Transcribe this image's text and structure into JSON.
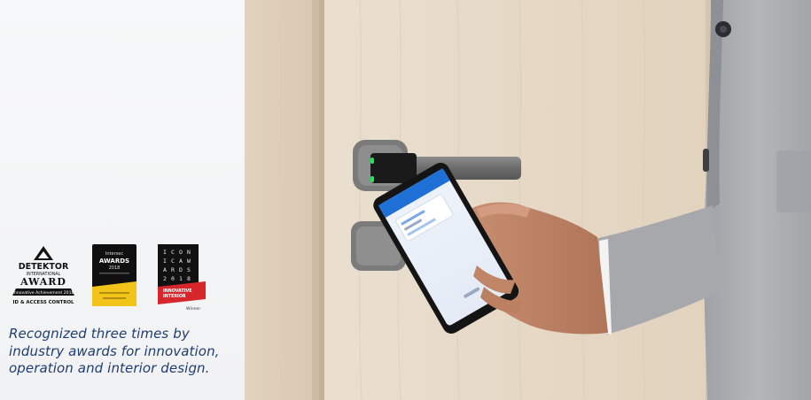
{
  "awards": {
    "detektor": {
      "title": "DETEKTOR",
      "subtitle": "INTERNATIONAL",
      "name": "AWARD",
      "category_bar": "Innovative Achievement 2018",
      "footer": "ID & ACCESS CONTROL",
      "colors": {
        "ink": "#111111",
        "bar": "#111111"
      }
    },
    "intersec": {
      "line1": "Intersec",
      "line2": "AWARDS",
      "line3": "2018",
      "colors": {
        "card": "#101010",
        "band": "#f2c318"
      }
    },
    "iconic": {
      "letters": [
        "I",
        "C",
        "O",
        "N",
        "I",
        "C",
        "A",
        "W",
        "A",
        "R",
        "D",
        "S",
        "2",
        "0",
        "1",
        "8"
      ],
      "ribbon_line1": "INNOVATIVE",
      "ribbon_line2": "INTERIOR",
      "footer": "Winner",
      "colors": {
        "card": "#111111",
        "ribbon": "#d7262b"
      }
    }
  },
  "caption": {
    "line1": "Recognized three times by",
    "line2": "industry awards for innovation,",
    "line3": "operation and interior design.",
    "color": "#1f3d73"
  },
  "photo": {
    "colors": {
      "door": "#e9dccb",
      "frame": "#e3d4c0",
      "suit": "#a9abae",
      "handle": "#6f6f70",
      "phone_screen": "#1e6fd6",
      "led": "#22e35a"
    },
    "icons": [
      "door-handle-icon",
      "smartphone-icon",
      "hand-icon"
    ]
  }
}
